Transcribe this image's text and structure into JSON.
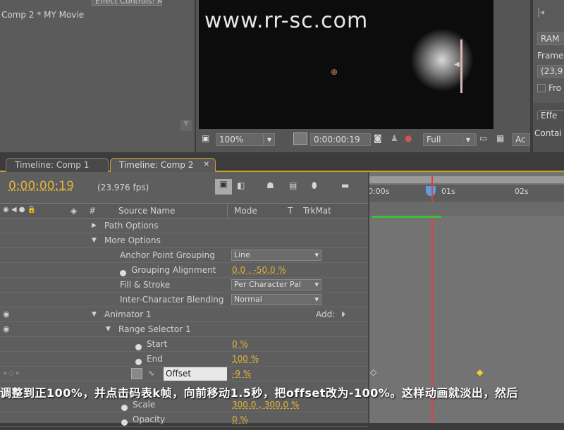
{
  "effect_controls": {
    "tab": "Effect Controls: MY Movie",
    "layer_path": "Comp 2 * MY Movie"
  },
  "viewer": {
    "watermark": "www.rr-sc.com",
    "zoom": "100%",
    "timecode": "0:00:00:19",
    "resolution": "Full",
    "active_camera": "Ac"
  },
  "right_panel": {
    "ram": "RAM P",
    "frame_rate_label": "Frame",
    "frame_rate": "(23,9",
    "from_label": "Fro",
    "effects_tab": "Effe",
    "contains": "Contai"
  },
  "tabs": [
    {
      "label": "Timeline: Comp 1"
    },
    {
      "label": "Timeline: Comp 2"
    }
  ],
  "timeline": {
    "current_time": "0:00:00:19",
    "fps": "(23.976 fps)",
    "columns": {
      "num": "#",
      "source": "Source Name",
      "mode": "Mode",
      "t": "T",
      "trkmat": "TrkMat"
    },
    "ruler": [
      "0:00s",
      "01s",
      "02s"
    ],
    "rows": [
      {
        "label": "Path Options"
      },
      {
        "label": "More Options"
      },
      {
        "label": "Anchor Point Grouping",
        "value": "Line"
      },
      {
        "label": "Grouping Alignment",
        "value": "0.0 , -50.0 %"
      },
      {
        "label": "Fill & Stroke",
        "value": "Per Character Pal"
      },
      {
        "label": "Inter-Character Blending",
        "value": "Normal"
      },
      {
        "label": "Animator 1",
        "add": "Add:"
      },
      {
        "label": "Range Selector 1"
      },
      {
        "label": "Start",
        "value": "0 %"
      },
      {
        "label": "End",
        "value": "100 %"
      },
      {
        "label": "Offset",
        "value": "-9 %"
      },
      {
        "label": "Scale",
        "value": "300.0 , 300.0 %"
      },
      {
        "label": "Opacity",
        "value": "0 %"
      }
    ]
  },
  "subtitle": "调整到正100%，并点击码表k帧，向前移动1.5秒，把offset改为-100%。这样动画就淡出，然后",
  "colors": {
    "accent": "#e0b33a",
    "cti": "#e04040",
    "workarea": "#3cc03c"
  }
}
